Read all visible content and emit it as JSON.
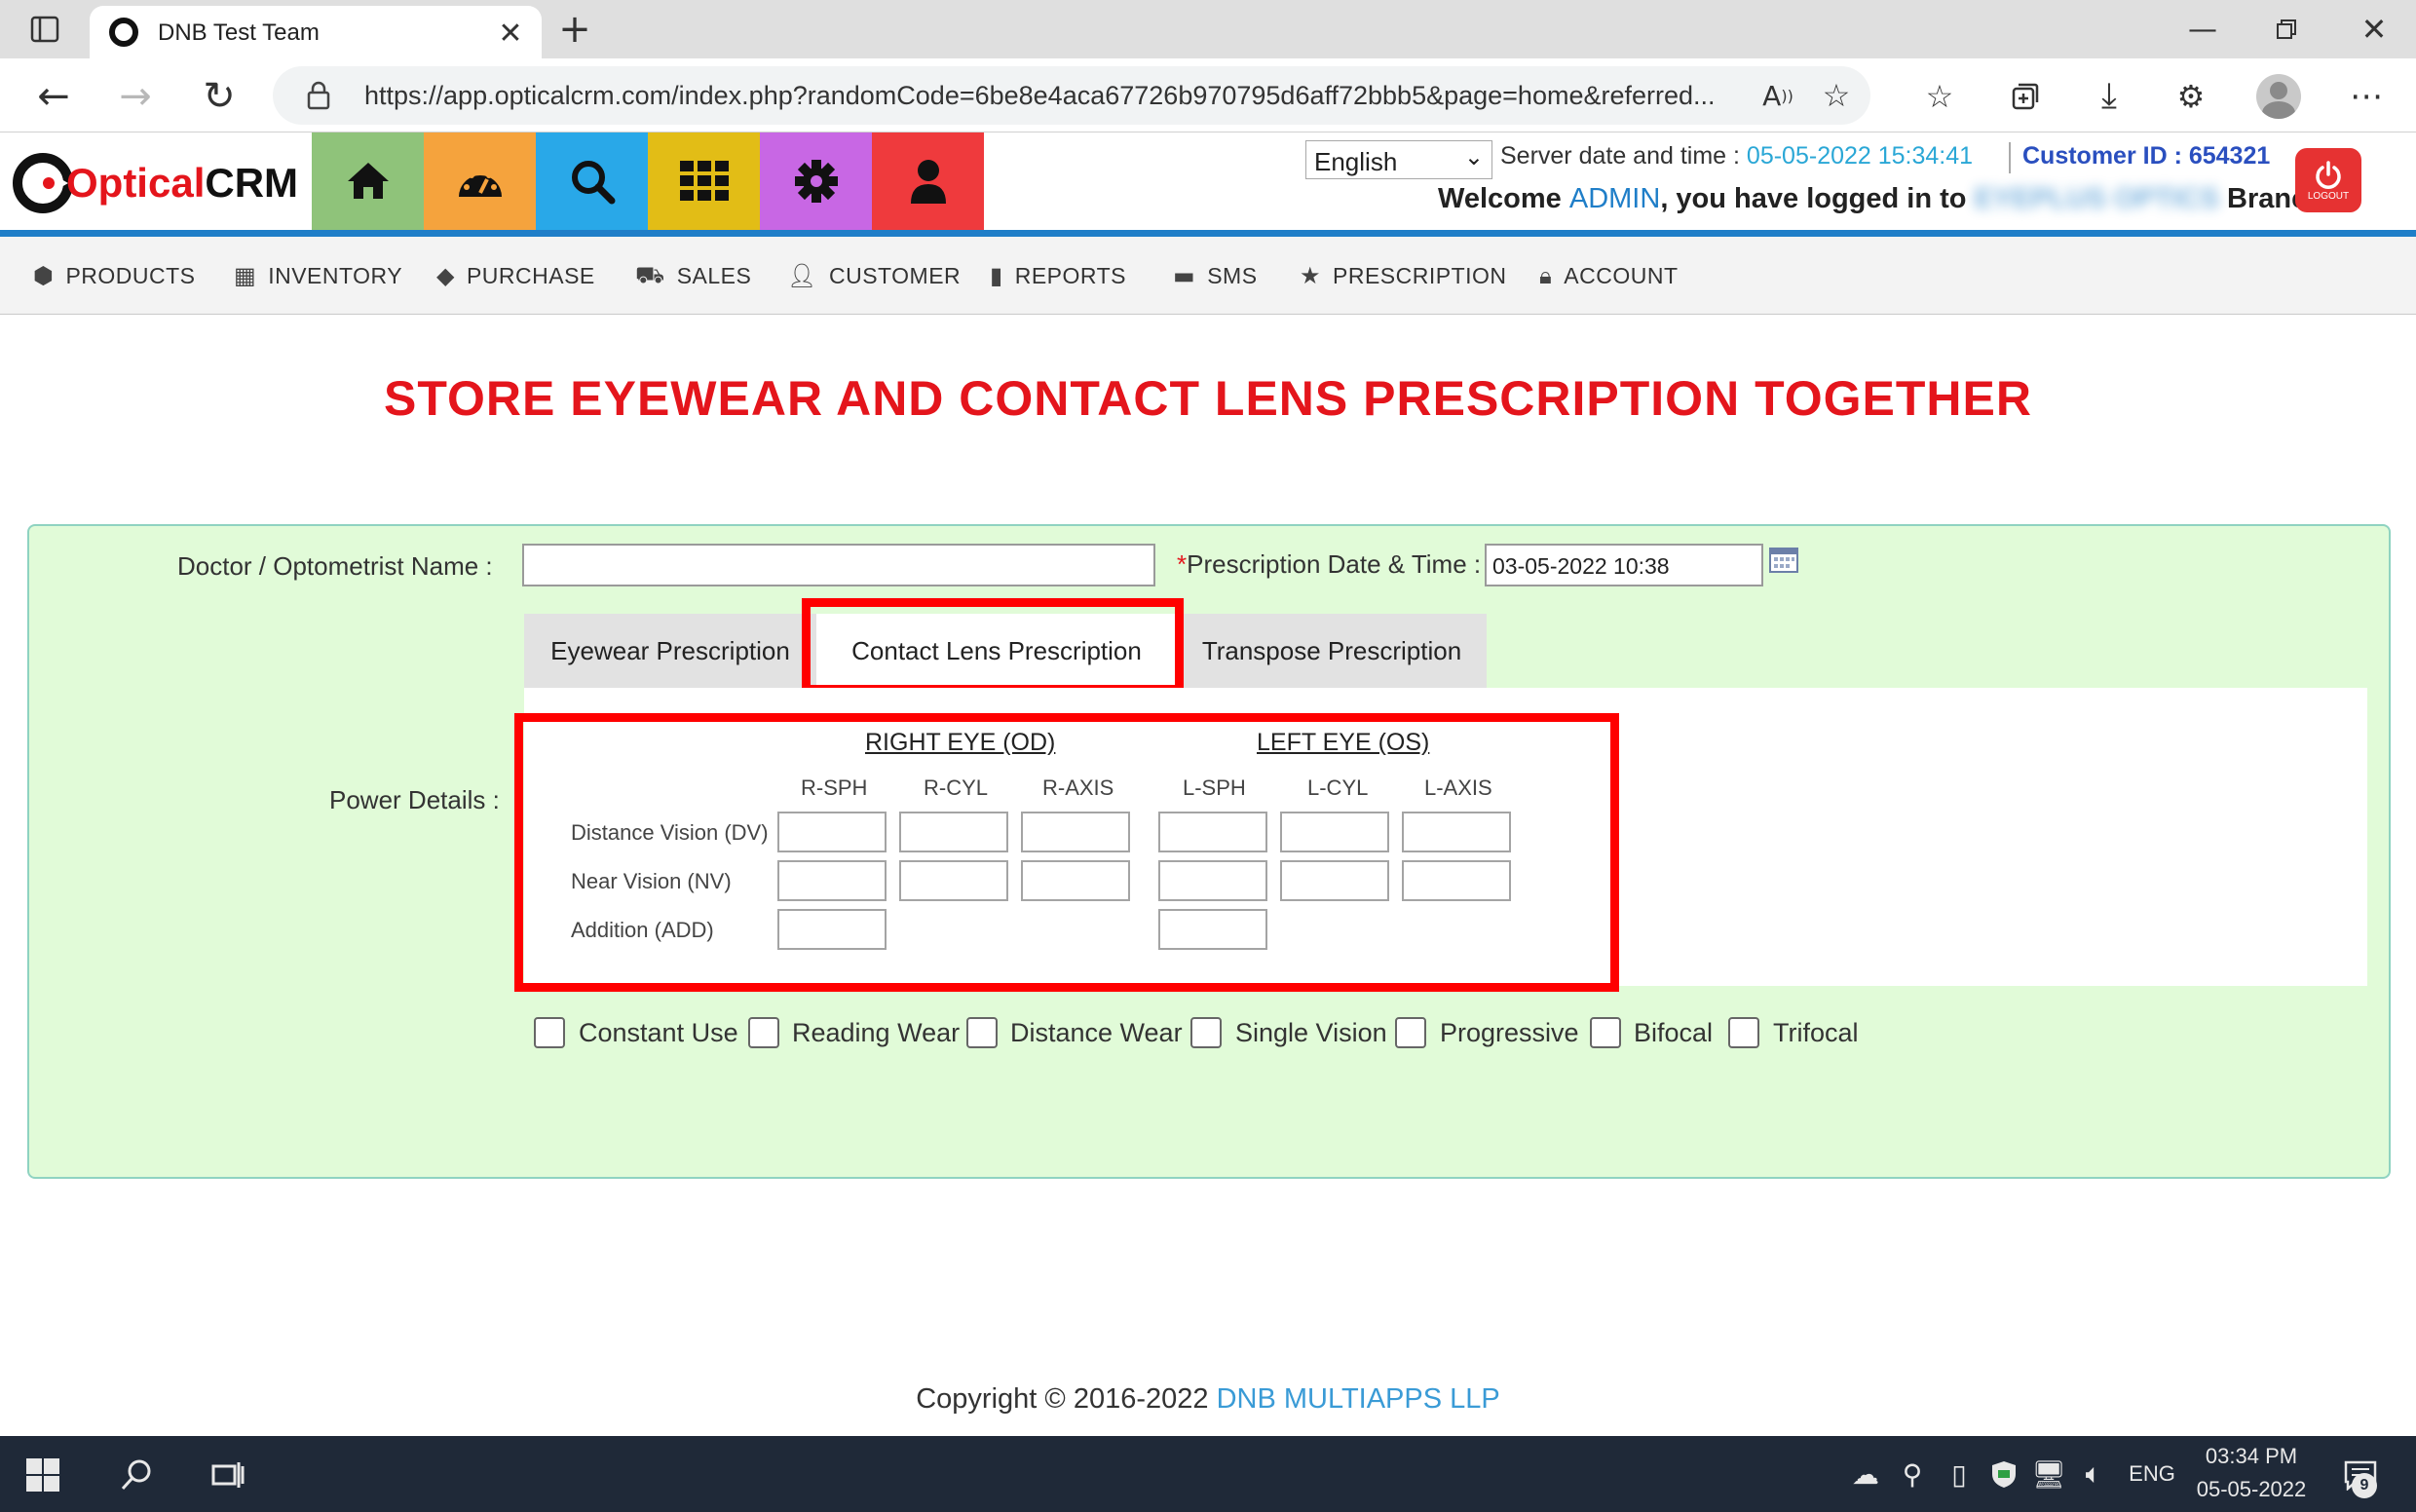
{
  "browser": {
    "tab_title": "DNB Test Team",
    "url": "https://app.opticalcrm.com/index.php?randomCode=6be8e4aca67726b970795d6aff72bbb5&page=home&referred..."
  },
  "header": {
    "logo_text_1": "Optical",
    "logo_text_2": "CRM",
    "language": "English",
    "server_label": "Server date and time :",
    "server_value": "05-05-2022 15:34:41",
    "customer_label": "Customer ID : 654321",
    "welcome_prefix": "Welcome",
    "welcome_user": "ADMIN",
    "welcome_suffix": ", you have logged in to",
    "branch_blurred": "EYEPLUS OPTICS",
    "branch_suffix": "Branch",
    "logout": "LOGOUT"
  },
  "icon_buttons": [
    {
      "name": "home-icon",
      "color": "#8fc37a"
    },
    {
      "name": "dashboard-icon",
      "color": "#f5a33d"
    },
    {
      "name": "search-icon",
      "color": "#29a8e8"
    },
    {
      "name": "grid-icon",
      "color": "#e2bd16"
    },
    {
      "name": "gear-icon",
      "color": "#c867e4"
    },
    {
      "name": "user-icon",
      "color": "#ef3a3d"
    }
  ],
  "nav": {
    "products": "PRODUCTS",
    "inventory": "INVENTORY",
    "purchase": "PURCHASE",
    "sales": "SALES",
    "customer": "CUSTOMER",
    "reports": "REPORTS",
    "sms": "SMS",
    "prescription": "PRESCRIPTION",
    "account": "ACCOUNT"
  },
  "page_title": "STORE EYEWEAR AND CONTACT LENS PRESCRIPTION TOGETHER",
  "form": {
    "doctor_label": "Doctor / Optometrist Name :",
    "doctor_value": "",
    "date_label_star": "*",
    "date_label": "Prescription Date & Time :",
    "date_value": "03-05-2022 10:38",
    "tabs": {
      "eyewear": "Eyewear Prescription",
      "contact": "Contact Lens Prescription",
      "transpose": "Transpose Prescription"
    },
    "power_label": "Power Details :",
    "right_eye": "RIGHT EYE (OD)",
    "left_eye": "LEFT EYE (OS)",
    "cols": [
      "R-SPH",
      "R-CYL",
      "R-AXIS",
      "L-SPH",
      "L-CYL",
      "L-AXIS"
    ],
    "rows": [
      "Distance Vision (DV)",
      "Near Vision (NV)",
      "Addition (ADD)"
    ],
    "checkboxes": [
      "Constant Use",
      "Reading Wear",
      "Distance Wear",
      "Single Vision",
      "Progressive",
      "Bifocal",
      "Trifocal"
    ]
  },
  "footer": {
    "copyright": "Copyright © 2016-2022",
    "company": "DNB MULTIAPPS LLP"
  },
  "taskbar": {
    "lang": "ENG",
    "time": "03:34 PM",
    "date": "05-05-2022",
    "notifications": "9"
  }
}
